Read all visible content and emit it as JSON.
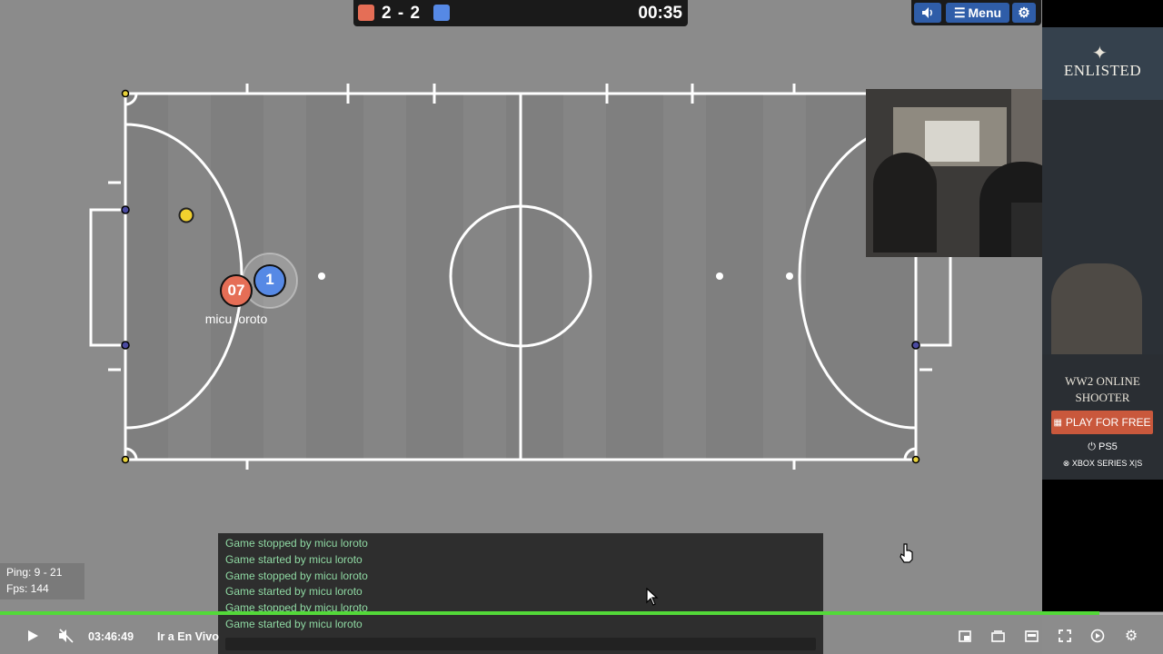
{
  "scoreboard": {
    "score": "2 - 2",
    "timer": "00:35",
    "colors": {
      "red": "#e56e56",
      "blue": "#5689e5"
    }
  },
  "toolbar": {
    "sound_icon": "speaker-icon",
    "menu_label": "Menu",
    "settings_icon": "gear-icon"
  },
  "players": {
    "red": {
      "label": "07",
      "name": "micu loroto",
      "color": "#e56e56"
    },
    "blue": {
      "label": "1",
      "color": "#5689e5"
    }
  },
  "ad": {
    "brand": "ENLISTED",
    "tagline_line1": "WW2 ONLINE",
    "tagline_line2": "SHOOTER",
    "cta": "PLAY FOR FREE",
    "platform1": "PS5",
    "platform2": "XBOX SERIES X|S"
  },
  "chat": {
    "messages": [
      "Game stopped by micu loroto",
      "Game started by micu loroto",
      "Game stopped by micu loroto",
      "Game started by micu loroto",
      "Game stopped by micu loroto",
      "Game started by micu loroto"
    ]
  },
  "stats": {
    "ping": "Ping: 9 - 21",
    "fps": "Fps: 144"
  },
  "player_controls": {
    "time": "03:46:49",
    "live_label": "Ir a En Vivo",
    "progress": 0.945
  }
}
